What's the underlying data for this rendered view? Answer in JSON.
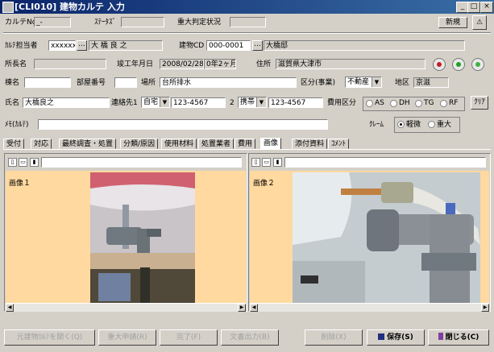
{
  "window": {
    "title": "[CLI010] 建物カルテ 入力",
    "minimize": "_",
    "maximize": "□",
    "close": "×"
  },
  "row1": {
    "karte_no_label": "カルテNo.",
    "karte_no_value": "_-",
    "status_label": "ｽﾃｰﾀｽﾞ",
    "status_value": "",
    "severity_label": "重大判定状況",
    "severity_value": "",
    "mode_badge": "新規"
  },
  "row2": {
    "person_label": "ｶﾙﾃ担当者",
    "person_code": "xxxxxx",
    "person_name": "大 橋 良 之",
    "building_cd_label": "建物CD",
    "building_cd_value": "000-0001",
    "building_name": "大橋邸"
  },
  "row3": {
    "branch_label": "所長名",
    "branch_value": "",
    "completion_label": "竣工年月日",
    "completion_date": "2008/02/28",
    "completion_age": "0年2ヶ月",
    "address_label": "住所",
    "address_value": "滋賀県大津市"
  },
  "row4": {
    "building_name_label": "棟名",
    "building_name_value": "",
    "room_label": "部屋番号",
    "room_value": "",
    "place_label": "場所",
    "place_value": "台所排水",
    "category_label": "区分(事業)",
    "category_value": "不動産",
    "district_label": "地区",
    "district_value": "京滋"
  },
  "row5": {
    "name_label": "氏名",
    "name_value": "大橋良之",
    "contact1_label": "連絡先1",
    "contact1_type": "自宅",
    "contact1_value": "123-4567",
    "contact2_label": "2",
    "contact2_type": "携帯",
    "contact2_value": "123-4567",
    "cost_label": "費用区分",
    "cost_options": [
      "AS",
      "DH",
      "TG",
      "RF"
    ],
    "clear_label": "ｸﾘｱ"
  },
  "row6": {
    "memo_label": "ﾒﾓ(ｶﾙﾃ)",
    "memo_value": "",
    "claim_label": "ｸﾚｰﾑ",
    "claim_options": [
      "軽微",
      "重大"
    ],
    "claim_selected": "軽微"
  },
  "tabs": [
    "受付",
    "対応",
    "最終調査・処置",
    "分類/原因",
    "使用材料",
    "処置業者",
    "費用",
    "画像",
    "添付資料",
    "ｺﾒﾝﾄ"
  ],
  "active_tab": "画像",
  "images": [
    {
      "label": "画像１",
      "path": ""
    },
    {
      "label": "画像２",
      "path": ""
    }
  ],
  "footer": {
    "btn1": "元建物ｶﾙﾃを開く(Q)",
    "btn2": "重大申請(R)",
    "btn3": "完了(F)",
    "btn4": "文書出力(B)",
    "btn5": "削除(X)",
    "save": "保存(S)",
    "close": "閉じる(C)"
  },
  "colors": {
    "title_start": "#0a246a",
    "title_end": "#3a6ea5",
    "face": "#d4d0c8",
    "image_bg": "#ffd9a0"
  }
}
